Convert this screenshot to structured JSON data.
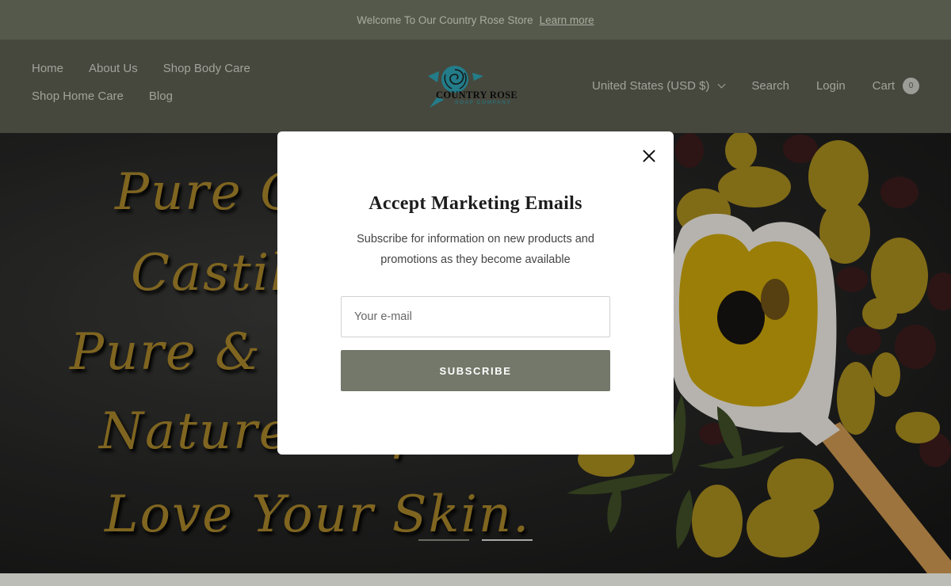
{
  "announcement": {
    "text": "Welcome To Our Country Rose Store",
    "link": "Learn more"
  },
  "header": {
    "nav_row1": [
      "Home",
      "About Us",
      "Shop Body Care"
    ],
    "nav_row2": [
      "Shop Home Care",
      "Blog"
    ],
    "logo": {
      "line1": "COUNTRY ROSE",
      "line2": "SOAP COMPANY"
    },
    "currency": "United States (USD $)",
    "search": "Search",
    "login": "Login",
    "cart": "Cart",
    "cart_count": "0"
  },
  "hero": {
    "lines": [
      "Pure Olive Oil",
      "Castile Soap",
      "Pure & Simple",
      "Nature Inspired",
      "Love Your Skin."
    ],
    "slides": 2,
    "active_slide": 2
  },
  "modal": {
    "title": "Accept Marketing Emails",
    "text": "Subscribe for information on new products and promotions as they become available",
    "email_placeholder": "Your e-mail",
    "button": "SUBSCRIBE"
  },
  "colors": {
    "announcement_bg": "#6e7260",
    "header_bg": "#5a5d50",
    "button_bg": "#73786a",
    "logo_teal": "#2e9fb0",
    "hero_text": "#a3822a"
  }
}
